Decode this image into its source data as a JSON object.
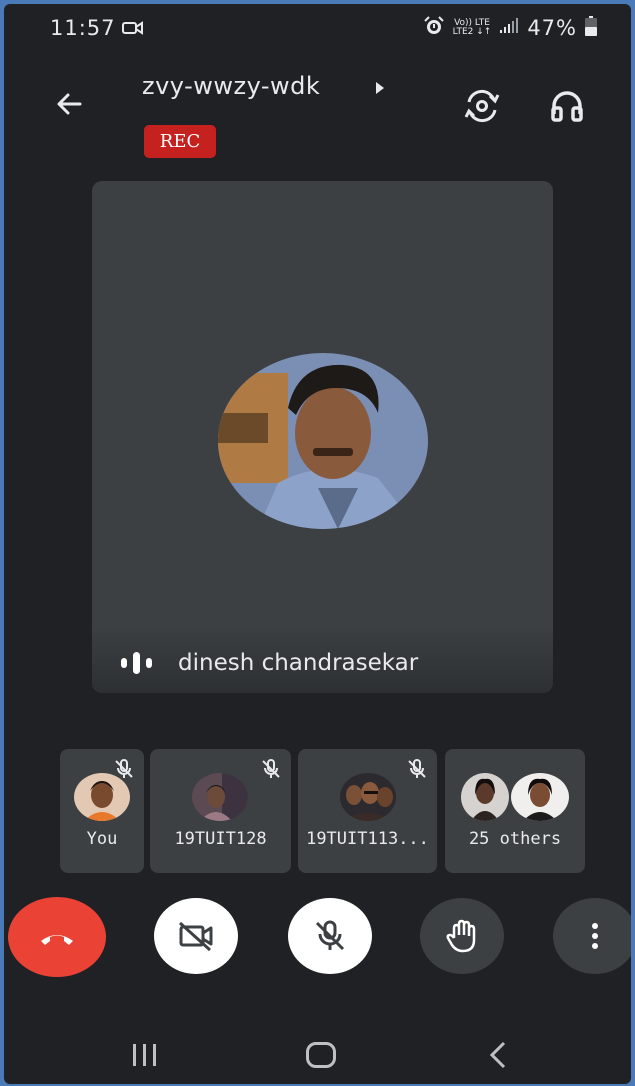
{
  "status_bar": {
    "time": "11:57",
    "network_top": "Vo)) LTE",
    "network_bottom": "LTE2 ↓↑",
    "battery": "47%"
  },
  "header": {
    "meeting_code": "zvy-wwzy-wdk",
    "rec_label": "REC",
    "icons": [
      "back-arrow-icon",
      "switch-camera-icon",
      "headphones-icon"
    ]
  },
  "main_speaker": {
    "name": "dinesh chandrasekar",
    "icon": "speaking-indicator-icon"
  },
  "participants": [
    {
      "label": "You",
      "muted": true
    },
    {
      "label": "19TUIT128",
      "muted": true
    },
    {
      "label": "19TUIT113...",
      "muted": true
    },
    {
      "label": "25 others",
      "muted": false
    }
  ],
  "controls": {
    "icons": [
      "end-call-icon",
      "camera-off-icon",
      "mic-off-icon",
      "raise-hand-icon",
      "more-vert-icon"
    ],
    "colors": {
      "end_call": "#ea4335",
      "active_white": "#ffffff",
      "dark": "#3c4043"
    }
  },
  "nav_bar": {
    "icons": [
      "recents-icon",
      "home-icon",
      "back-icon"
    ]
  }
}
